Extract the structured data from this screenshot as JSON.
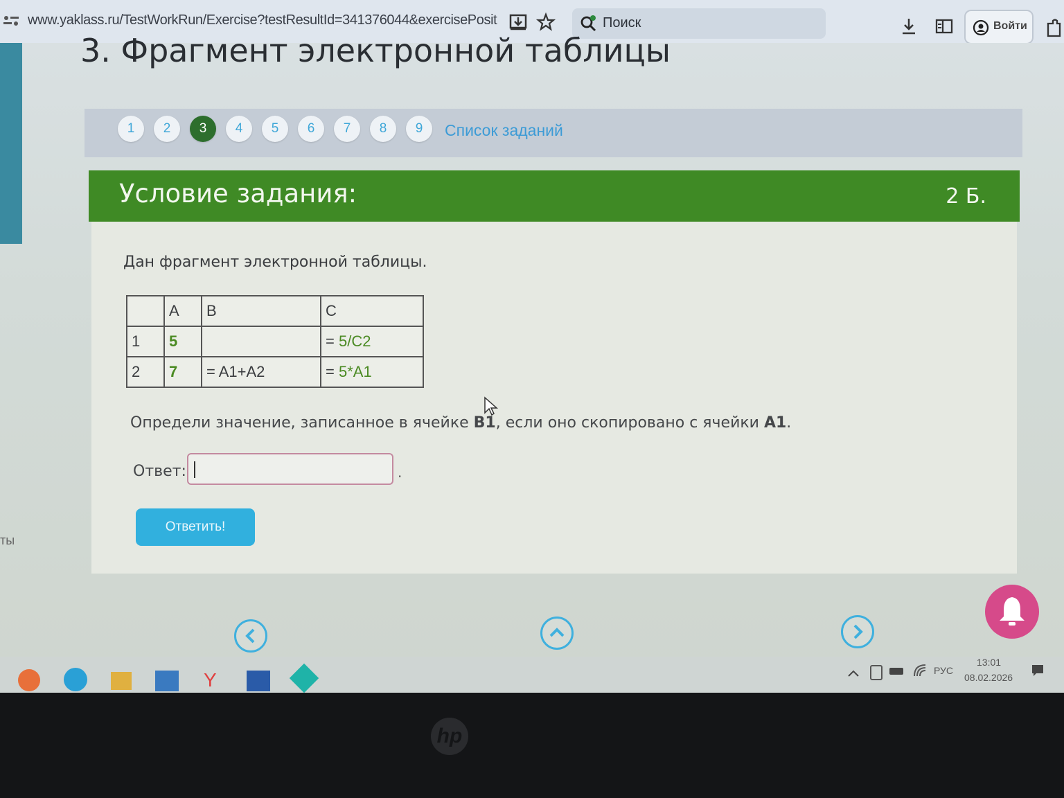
{
  "browser": {
    "url": "www.yaklass.ru/TestWorkRun/Exercise?testResultId=341376044&exercisePosit",
    "search_label": "Поиск",
    "login_label": "Войти"
  },
  "page": {
    "title": "3. Фрагмент электронной таблицы",
    "pager": {
      "pages": [
        "1",
        "2",
        "3",
        "4",
        "5",
        "6",
        "7",
        "8",
        "9"
      ],
      "active": "3",
      "task_list_label": "Список заданий"
    },
    "left_partial_text": "ты"
  },
  "task": {
    "header": "Условие задания:",
    "points": "2 Б.",
    "intro": "Дан фрагмент электронной таблицы.",
    "table": {
      "headers": [
        "",
        "A",
        "B",
        "C"
      ],
      "rows": [
        {
          "num": "1",
          "a": "5",
          "b": "",
          "c_prefix": "= ",
          "c_value": "5/C2"
        },
        {
          "num": "2",
          "a": "7",
          "b": "= A1+A2",
          "c_prefix": "= ",
          "c_value": "5*A1"
        }
      ]
    },
    "question_part1": "Определи значение, записанное в ячейке ",
    "question_cell1": "B1",
    "question_part2": ", если оно скопировано с ячейки ",
    "question_cell2": "A1",
    "question_end": ".",
    "answer_label": "Ответ:",
    "answer_value": "",
    "answer_suffix": ".",
    "submit_label": "Ответить!"
  },
  "taskbar": {
    "language": "РУС",
    "time": "13:01",
    "date": "08.02.2026"
  },
  "colors": {
    "header_green": "#3f8a25",
    "active_page": "#2d6e2d",
    "link_blue": "#3c9bd6",
    "button_blue": "#31b0de",
    "bell_pink": "#d64a8a",
    "value_green": "#4a8a22"
  }
}
